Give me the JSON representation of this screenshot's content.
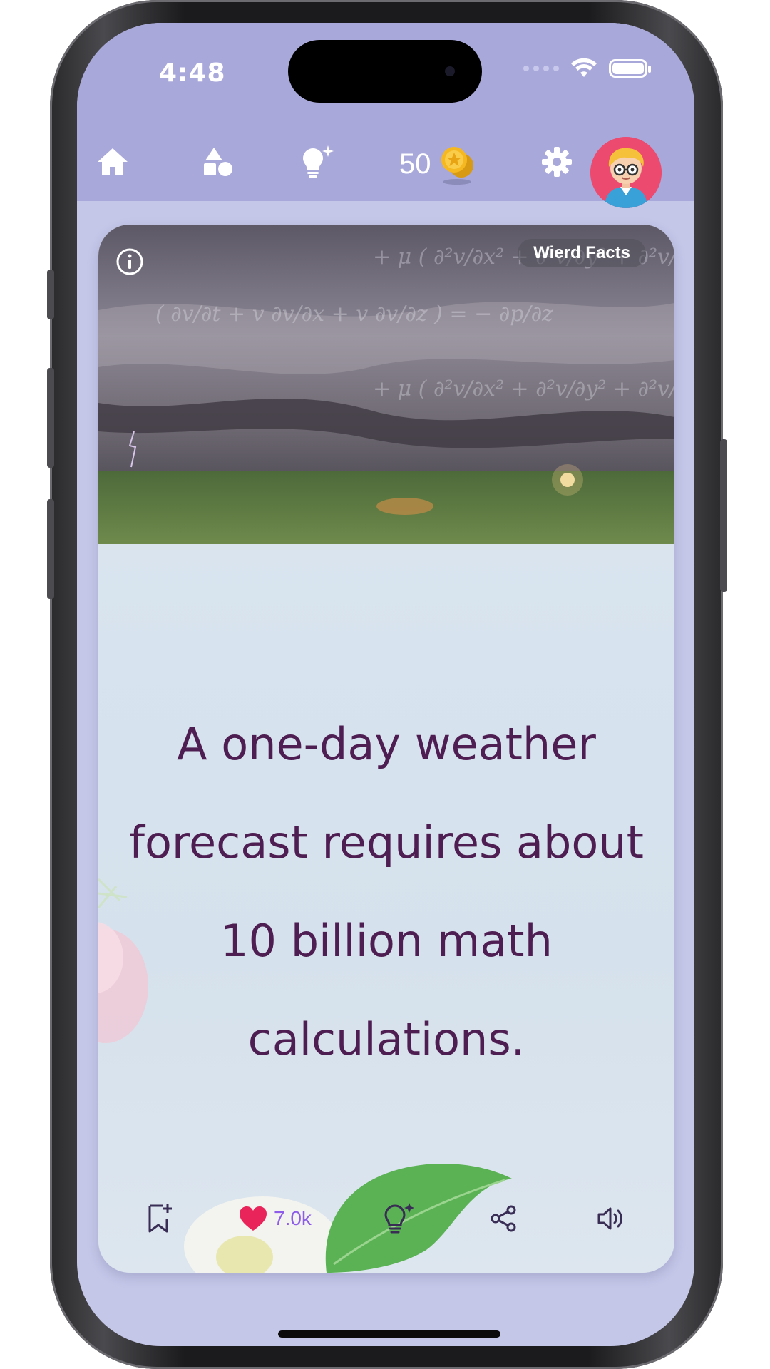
{
  "status_bar": {
    "time": "4:48"
  },
  "navbar": {
    "coins": "50",
    "items": [
      "home-icon",
      "shapes-icon",
      "lightbulb-sparkle-icon",
      "coin-icon",
      "gear-icon",
      "avatar"
    ]
  },
  "card": {
    "category": "Wierd Facts",
    "fact": "A one-day weather forecast requires about 10 billion math calculations.",
    "likes": "7.0k"
  },
  "colors": {
    "header": "#a9a8da",
    "background": "#c5c7e9",
    "text": "#4e1d52",
    "heart": "#e8245a",
    "like_count": "#8d5ce8"
  }
}
